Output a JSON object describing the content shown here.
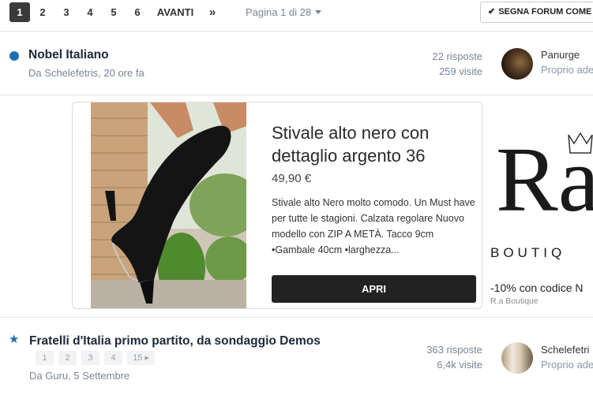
{
  "pagination": {
    "pages": [
      "1",
      "2",
      "3",
      "4",
      "5",
      "6"
    ],
    "active_page": "1",
    "next_label": "AVANTI",
    "last_label": "»",
    "page_info": "Pagina 1 di 28",
    "mark_read_label": "SEGNA FORUM COME LE"
  },
  "topics": [
    {
      "title": "Nobel Italiano",
      "meta": "Da Schelefetris, 20 ore fa",
      "replies": "22 risposte",
      "views": "259 visite",
      "last_user": "Panurge",
      "last_time": "Proprio ade"
    },
    {
      "title": "Fratelli d'Italia primo partito, da sondaggio Demos",
      "meta": "Da Guru, 5 Settembre",
      "mini_pages": [
        "1",
        "2",
        "3",
        "4",
        "15"
      ],
      "replies": "363 risposte",
      "views": "6,4k visite",
      "last_user": "Schelefetri",
      "last_time": "Proprio ade"
    }
  ],
  "ad": {
    "title": "Stivale alto nero con dettaglio argento 36",
    "price": "49,90 €",
    "description": "Stivale alto Nero molto comodo. Un Must have per tutte le stagioni. Calzata regolare Nuovo modello con ZIP A METÀ. Tacco 9cm •Gambale 40cm •larghezza...",
    "button_label": "APRI",
    "brand_logo_text": "Ra",
    "brand_subtitle": "BOUTIQ",
    "offer": "-10% con codice N",
    "brand_name": "R.a Boutique"
  },
  "colors": {
    "accent": "#1f6fb0",
    "dark": "#222222"
  }
}
